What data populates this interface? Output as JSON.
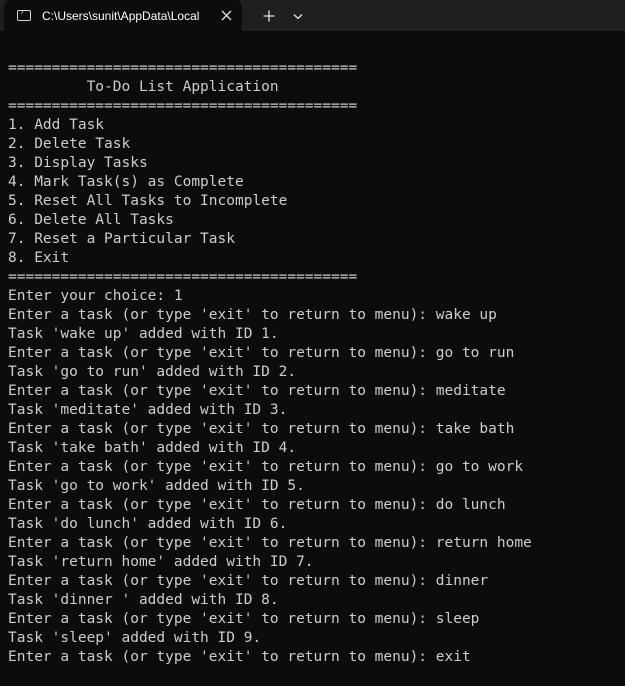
{
  "window": {
    "tab_title": "C:\\Users\\sunit\\AppData\\Local",
    "icons": {
      "terminal": "terminal-icon",
      "close": "close-icon",
      "new_tab": "plus-icon",
      "dropdown": "chevron-down-icon"
    }
  },
  "colors": {
    "background": "#0c0c0c",
    "titlebar": "#1f1f1f",
    "text": "#cccccc"
  },
  "terminal": {
    "lines": [
      "========================================",
      "         To-Do List Application",
      "========================================",
      "1. Add Task",
      "2. Delete Task",
      "3. Display Tasks",
      "4. Mark Task(s) as Complete",
      "5. Reset All Tasks to Incomplete",
      "6. Delete All Tasks",
      "7. Reset a Particular Task",
      "8. Exit",
      "========================================",
      "Enter your choice: 1",
      "Enter a task (or type 'exit' to return to menu): wake up",
      "Task 'wake up' added with ID 1.",
      "Enter a task (or type 'exit' to return to menu): go to run",
      "Task 'go to run' added with ID 2.",
      "Enter a task (or type 'exit' to return to menu): meditate",
      "Task 'meditate' added with ID 3.",
      "Enter a task (or type 'exit' to return to menu): take bath",
      "Task 'take bath' added with ID 4.",
      "Enter a task (or type 'exit' to return to menu): go to work",
      "Task 'go to work' added with ID 5.",
      "Enter a task (or type 'exit' to return to menu): do lunch",
      "Task 'do lunch' added with ID 6.",
      "Enter a task (or type 'exit' to return to menu): return home",
      "Task 'return home' added with ID 7.",
      "Enter a task (or type 'exit' to return to menu): dinner",
      "Task 'dinner ' added with ID 8.",
      "Enter a task (or type 'exit' to return to menu): sleep",
      "Task 'sleep' added with ID 9.",
      "Enter a task (or type 'exit' to return to menu): exit"
    ]
  }
}
